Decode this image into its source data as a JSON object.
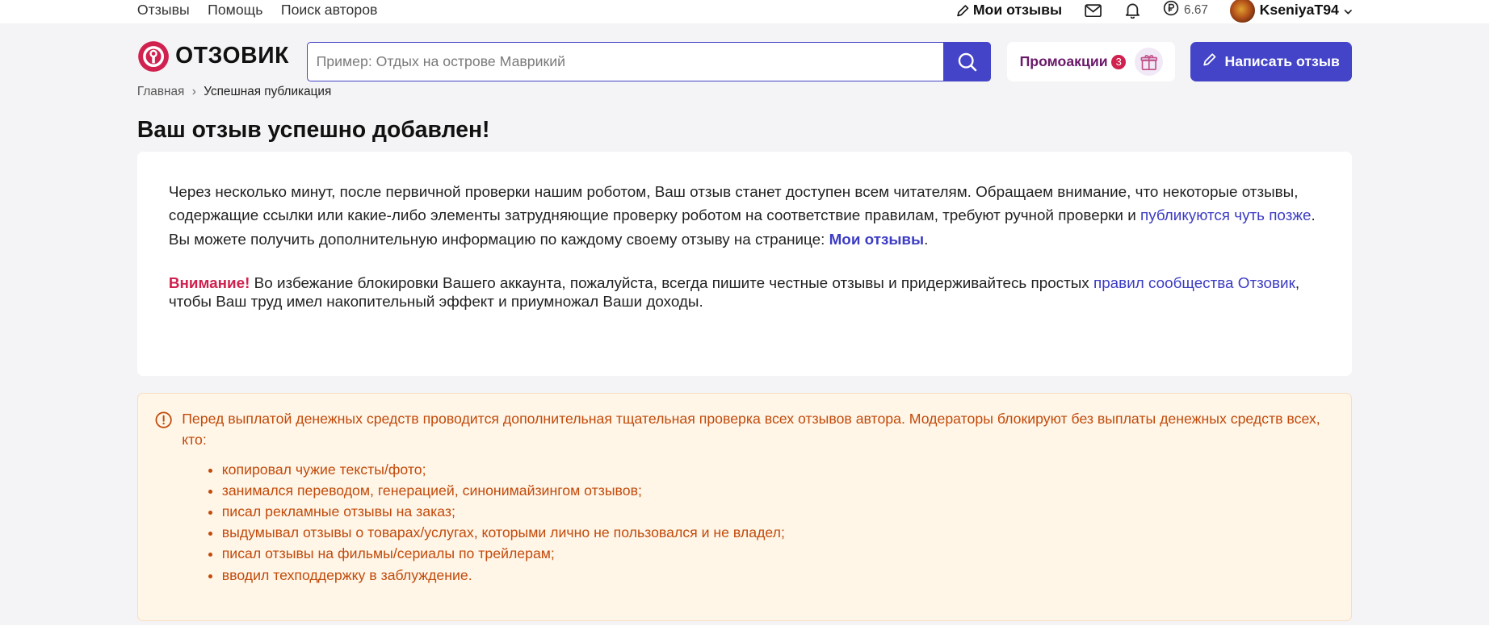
{
  "topbar": {
    "links": [
      "Отзывы",
      "Помощь",
      "Поиск авторов"
    ],
    "my_reviews": "Мои отзывы",
    "balance": "6.67",
    "username": "KseniyaT94",
    "icons": [
      "pencil-icon",
      "mail-icon",
      "bell-icon",
      "ruble-icon",
      "chevron-down-icon"
    ]
  },
  "header": {
    "logo_text": "ОТЗОВИК",
    "search_placeholder": "Пример: Отдых на острове Маврикий",
    "promo_label": "Промоакции",
    "promo_count": "3",
    "write_label": "Написать отзыв"
  },
  "breadcrumb": {
    "home": "Главная",
    "separator": "›",
    "current": "Успешная публикация"
  },
  "page_title": "Ваш отзыв успешно добавлен!",
  "notice": {
    "text1": "Через несколько минут, после первичной проверки нашим роботом, Ваш отзыв станет доступен всем читателям. Обращаем внимание, что некоторые отзывы, содержащие ссылки или какие-либо элементы затрудняющие проверку роботом на соответствие правилам, требуют ручной проверки и ",
    "link_later": "публикуются чуть позже",
    "text2": ". Вы можете получить дополнительную информацию по каждому своему отзыву на странице: ",
    "link_my_reviews": "Мои отзывы",
    "text3": ".",
    "attention": "Внимание!",
    "text4": " Во избежание блокировки Вашего аккаунта, пожалуйста, всегда пишите честные отзывы и придерживайтесь простых ",
    "link_rules": "правил сообщества Отзовик",
    "text5": ", чтобы Ваш труд имел накопительный эффект и приумножал Ваши доходы."
  },
  "alert": {
    "intro": "Перед выплатой денежных средств проводится дополнительная тщательная проверка всех отзывов автора. Модераторы блокируют без выплаты денежных средств всех, кто:",
    "items": [
      "копировал чужие тексты/фото;",
      "занимался переводом, генерацией, синонимайзингом отзывов;",
      "писал рекламные отзывы на заказ;",
      "выдумывал отзывы о товарах/услугах, которыми лично не пользовался и не владел;",
      "писал отзывы на фильмы/сериалы по трейлерам;",
      "вводил техподдержку в заблуждение."
    ]
  },
  "colors": {
    "accent": "#4444c8",
    "brand_red": "#d0214f",
    "promo_purple": "#6a1a6a",
    "alert_text": "#c24a0a",
    "alert_bg": "#fff6e8",
    "page_bg": "#f4f4f6"
  }
}
